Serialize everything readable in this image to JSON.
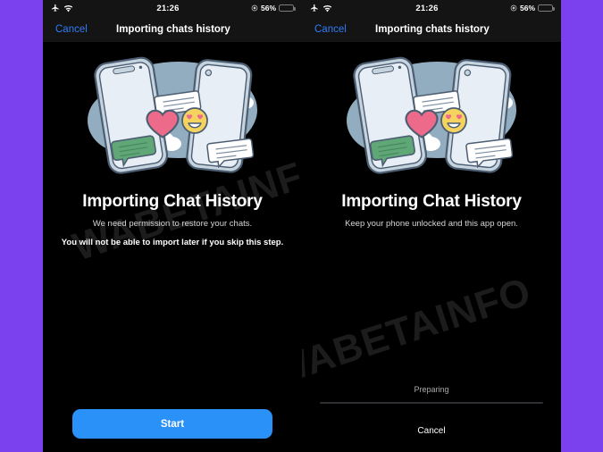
{
  "theme": {
    "page_background": "#7C41EE",
    "screen_background": "#000000",
    "bar_background": "#141414",
    "accent_blue": "#2A91F9",
    "link_blue": "#2F7CF6",
    "battery_yellow": "#F7CE46",
    "watermark_color": "#1C1C1C"
  },
  "watermark": {
    "text": "WABETAINFO"
  },
  "status_bar": {
    "airplane_icon": "airplane-mode-icon",
    "wifi_icon": "wifi-icon",
    "time": "21:26",
    "location_icon": "location-services-icon",
    "battery_percent": "56%",
    "battery_level": 56
  },
  "panels": [
    {
      "id": "permission-screen",
      "nav": {
        "cancel_label": "Cancel",
        "title": "Importing chats history"
      },
      "illustration": {
        "name": "two-phones-chat-transfer-illustration",
        "blob_color": "#92ADC0",
        "phone_body": "#DCE6EF",
        "phone_outline": "#4D5E72",
        "heart_color": "#EE6A8A",
        "emoji_color": "#F4D35E",
        "green_bubble": "#5FA777",
        "cloud_color": "#FFFFFF"
      },
      "headline": "Importing Chat History",
      "subline": "We need permission to restore your chats.",
      "warning": "You will not be able to import later if you skip this step.",
      "primary_button": "Start"
    },
    {
      "id": "progress-screen",
      "nav": {
        "cancel_label": "Cancel",
        "title": "Importing chats history"
      },
      "illustration": {
        "name": "two-phones-chat-transfer-illustration",
        "blob_color": "#92ADC0",
        "phone_body": "#DCE6EF",
        "phone_outline": "#4D5E72",
        "heart_color": "#EE6A8A",
        "emoji_color": "#F4D35E",
        "green_bubble": "#5FA777",
        "cloud_color": "#FFFFFF"
      },
      "headline": "Importing Chat History",
      "subline": "Keep your phone unlocked and this app open.",
      "progress": {
        "status_label": "Preparing",
        "percent": 0
      },
      "cancel_button": "Cancel"
    }
  ]
}
